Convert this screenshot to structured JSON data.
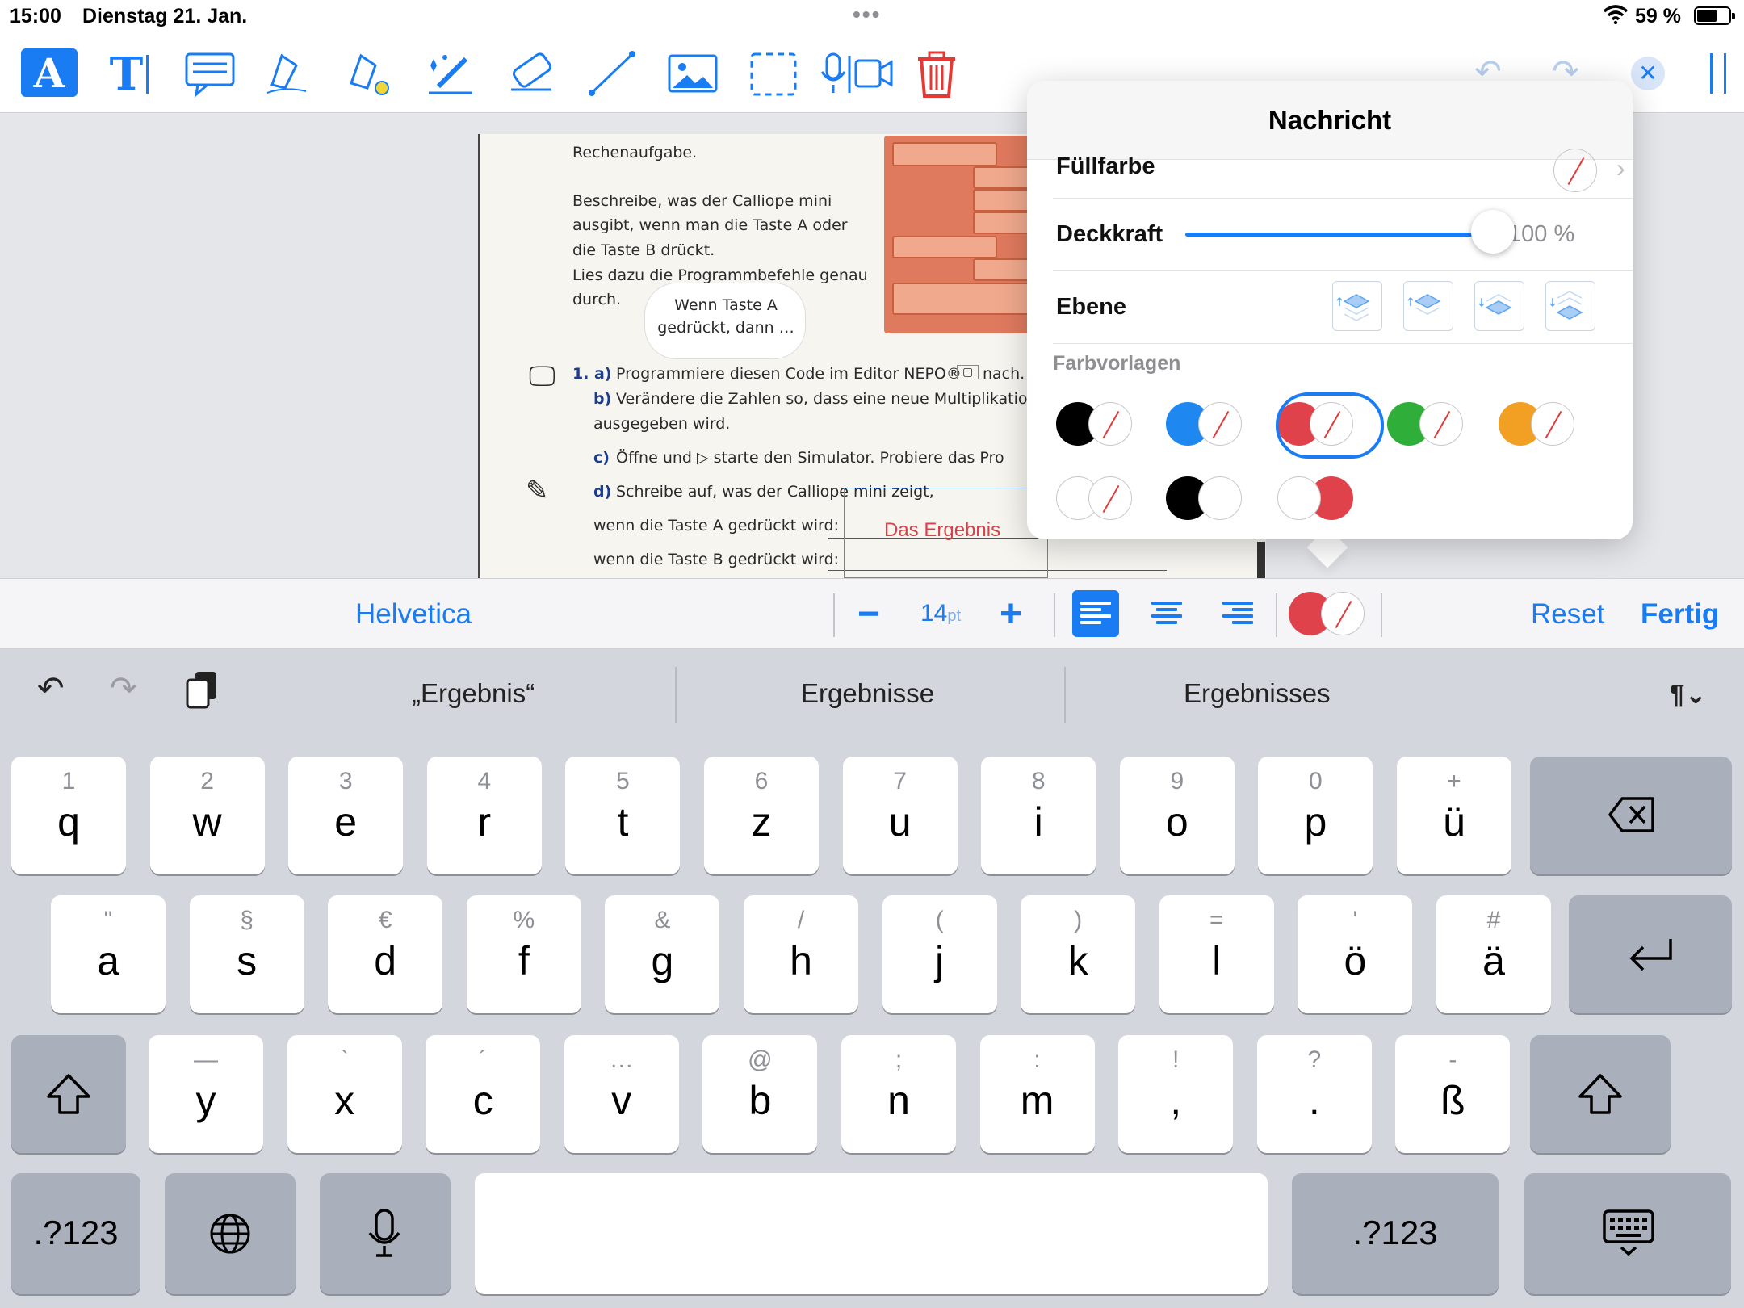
{
  "status": {
    "time": "15:00",
    "date": "Dienstag 21. Jan.",
    "battery": "59 %"
  },
  "toolbar": {
    "tools": [
      "text-box-tool",
      "text-tool",
      "comment-tool",
      "pen-tool",
      "highlighter-tool",
      "magic-pen-tool",
      "eraser-tool",
      "line-tool",
      "image-tool",
      "selection-tool",
      "audio-video-tool",
      "delete-tool"
    ],
    "text_tool_label": "A",
    "text_t_label": "T"
  },
  "document": {
    "lines": [
      "Rechenaufgabe.",
      "Beschreibe, was der Calliope mini",
      "ausgibt, wenn man die Taste A oder",
      "die Taste B drückt.",
      "Lies dazu die Programmbefehle genau",
      "durch."
    ],
    "bubble_line1": "Wenn Taste A",
    "bubble_line2": "gedrückt, dann …",
    "task1a_num": "1. a)",
    "task1a": "Programmiere diesen Code im Editor NEPO®",
    "task1a_end": "nach.",
    "task1b_num": "b)",
    "task1b": "Verändere die Zahlen so, dass eine neue Multiplikationsa",
    "task1b_2": "ausgegeben wird.",
    "task1c_num": "c)",
    "task1c": "Öffne und ▷ starte den Simulator. Probiere das Pro",
    "task1d_num": "d)",
    "task1d": "Schreibe auf, was der Calliope mini zeigt,",
    "line_a": "wenn die Taste A gedrückt wird:",
    "line_b": "wenn die Taste B gedrückt wird:",
    "answer_text": "Das Ergebnis"
  },
  "popover": {
    "title": "Nachricht",
    "fill_label": "Füllfarbe",
    "opacity_label": "Deckkraft",
    "opacity_value": "100 %",
    "opacity": 1.0,
    "layer_label": "Ebene",
    "presets_label": "Farbvorlagen",
    "presets_row1": [
      "#000000",
      "#1f87f0",
      "#e0424c",
      "#2fae3a",
      "#f2a024"
    ],
    "presets_row2": [
      "#ffffff",
      "#000000",
      "#ffffff"
    ],
    "preset_row2_third_right": "#e0424c",
    "selected_preset": 2
  },
  "formatbar": {
    "font": "Helvetica",
    "size": "14",
    "size_unit": "pt",
    "reset": "Reset",
    "done": "Fertig",
    "text_color": "#e0424c"
  },
  "keyboard": {
    "suggestions": [
      "„Ergebnis“",
      "Ergebnisse",
      "Ergebnisses"
    ],
    "row1": [
      [
        "1",
        "q"
      ],
      [
        "2",
        "w"
      ],
      [
        "3",
        "e"
      ],
      [
        "4",
        "r"
      ],
      [
        "5",
        "t"
      ],
      [
        "6",
        "z"
      ],
      [
        "7",
        "u"
      ],
      [
        "8",
        "i"
      ],
      [
        "9",
        "o"
      ],
      [
        "0",
        "p"
      ],
      [
        "+",
        "ü"
      ]
    ],
    "row2": [
      [
        "\"",
        "a"
      ],
      [
        "§",
        "s"
      ],
      [
        "€",
        "d"
      ],
      [
        "%",
        "f"
      ],
      [
        "&",
        "g"
      ],
      [
        "/",
        "h"
      ],
      [
        "(",
        "j"
      ],
      [
        ")",
        "k"
      ],
      [
        "=",
        "l"
      ],
      [
        "'",
        "ö"
      ],
      [
        "#",
        "ä"
      ]
    ],
    "row3": [
      [
        "—",
        "y"
      ],
      [
        "`",
        "x"
      ],
      [
        "´",
        "c"
      ],
      [
        "…",
        "v"
      ],
      [
        "@",
        "b"
      ],
      [
        ";",
        "n"
      ],
      [
        ":",
        "m"
      ],
      [
        "!",
        ","
      ],
      [
        "?",
        "."
      ],
      [
        "-",
        "ß"
      ]
    ],
    "numbers_label": ".?123",
    "numbers_label_right": ".?123"
  }
}
